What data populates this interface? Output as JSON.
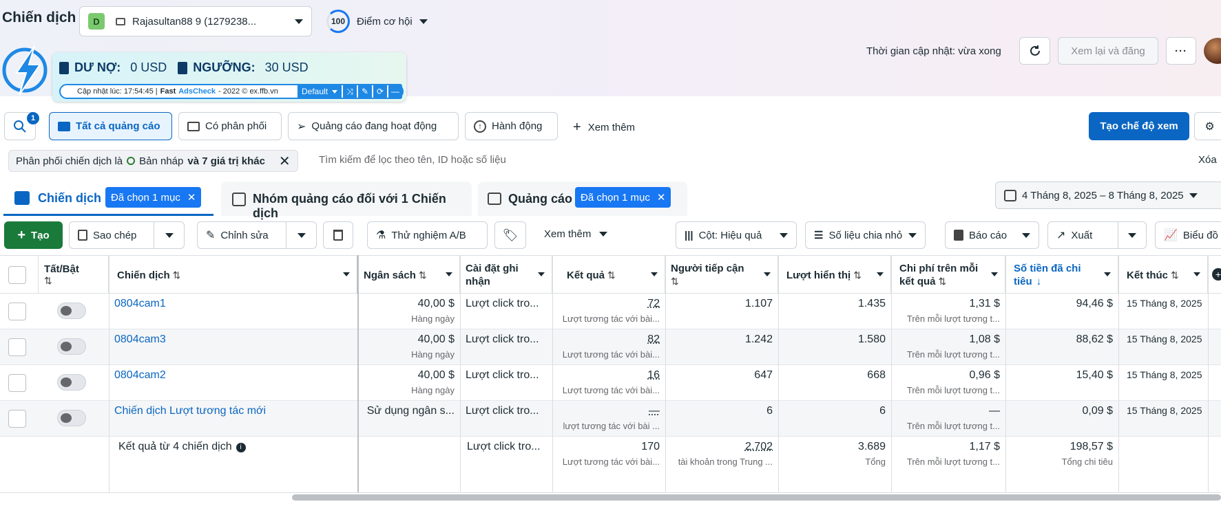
{
  "header": {
    "title": "Chiến dịch",
    "account_badge": "D",
    "account_name": "Rajasultan88 9 (1279238...",
    "score_value": "100",
    "score_label": "Điểm cơ hội",
    "update_time": "Thời gian cập nhật: vừa xong",
    "review_btn": "Xem lại và đăng"
  },
  "extension": {
    "debt_label": "DƯ NỢ:",
    "debt_value": "0 USD",
    "threshold_label": "NGƯỠNG:",
    "threshold_value": "30 USD",
    "updated_prefix": "Cập nhật lúc: 17:54:45 |",
    "brand_fast": "Fast",
    "brand_ads": "AdsCheck",
    "footer_text": "- 2022 © ex.ffb.vn",
    "preset": "Default"
  },
  "filters": {
    "search_badge": "1",
    "tabs": [
      "Tất cả quảng cáo",
      "Có phân phối",
      "Quảng cáo đang hoạt động",
      "Hành động"
    ],
    "more": "Xem thêm",
    "create_view": "Tạo chế độ xem"
  },
  "filter_bar": {
    "chip_prefix": "Phân phối chiến dịch là",
    "chip_value": "Bản nháp",
    "chip_more": "và 7 giá trị khác",
    "search_placeholder": "Tìm kiếm để lọc theo tên, ID hoặc số liệu",
    "clear": "Xóa"
  },
  "levels": {
    "campaign": "Chiến dịch",
    "campaign_selected": "Đã chọn 1 mục",
    "adset": "Nhóm quảng cáo đối với 1 Chiến dịch",
    "ad": "Quảng cáo",
    "ad_selected": "Đã chọn 1 mục",
    "date_range": "4 Tháng 8, 2025 – 8 Tháng 8, 2025"
  },
  "toolbar": {
    "create": "Tạo",
    "duplicate": "Sao chép",
    "edit": "Chỉnh sửa",
    "ab_test": "Thử nghiệm A/B",
    "more": "Xem thêm",
    "columns": "Cột: Hiệu quả",
    "breakdown": "Số liệu chia nhỏ",
    "reports": "Báo cáo",
    "export": "Xuất",
    "charts": "Biểu đồ"
  },
  "columns": {
    "toggle": "Tất/Bật",
    "campaign": "Chiến dịch",
    "budget": "Ngân sách",
    "attribution_1": "Cài đặt ghi",
    "attribution_2": "nhận",
    "results": "Kết quả",
    "reach_1": "Người tiếp cận",
    "impressions": "Lượt hiển thị",
    "cpr_1": "Chi phí trên mỗi",
    "cpr_2": "kết quả",
    "spent_1": "Số tiền đã chi",
    "spent_2": "tiêu",
    "ends": "Kết thúc"
  },
  "rows": [
    {
      "name": "0804cam1",
      "budget": "40,00 $",
      "budget_sub": "Hàng ngày",
      "attribution": "Lượt click tro...",
      "results": "72",
      "results_sub": "Lượt tương tác với bài...",
      "reach": "1.107",
      "impressions": "1.435",
      "cpr": "1,31 $",
      "cpr_sub": "Trên mỗi lượt tương t...",
      "spent": "94,46 $",
      "ends": "15 Tháng 8, 2025"
    },
    {
      "name": "0804cam3",
      "budget": "40,00 $",
      "budget_sub": "Hàng ngày",
      "attribution": "Lượt click tro...",
      "results": "82",
      "results_sub": "Lượt tương tác với bài...",
      "reach": "1.242",
      "impressions": "1.580",
      "cpr": "1,08 $",
      "cpr_sub": "Trên mỗi lượt tương t...",
      "spent": "88,62 $",
      "ends": "15 Tháng 8, 2025"
    },
    {
      "name": "0804cam2",
      "budget": "40,00 $",
      "budget_sub": "Hàng ngày",
      "attribution": "Lượt click tro...",
      "results": "16",
      "results_sub": "Lượt tương tác với bài...",
      "reach": "647",
      "impressions": "668",
      "cpr": "0,96 $",
      "cpr_sub": "Trên mỗi lượt tương t...",
      "spent": "15,40 $",
      "ends": "15 Tháng 8, 2025"
    },
    {
      "name": "Chiến dịch Lượt tương tác mới",
      "budget": "Sử dụng ngân s...",
      "budget_sub": "",
      "attribution": "Lượt click tro...",
      "results": "—",
      "results_sub": "lượt tương tác với bài ...",
      "reach": "6",
      "impressions": "6",
      "cpr": "—",
      "cpr_sub": "Trên mỗi lượt tương t...",
      "spent": "0,09 $",
      "ends": "15 Tháng 8, 2025"
    }
  ],
  "summary": {
    "label": "Kết quả từ 4 chiến dịch",
    "attribution": "Lượt click tro...",
    "results": "170",
    "results_sub": "Lượt tương tác với bài...",
    "reach": "2.702",
    "reach_sub": "tài khoản trong Trung ...",
    "impressions": "3.689",
    "impressions_sub": "Tổng",
    "cpr": "1,17 $",
    "cpr_sub": "Trên mỗi lượt tương t...",
    "spent": "198,57 $",
    "spent_sub": "Tổng chi tiêu"
  }
}
